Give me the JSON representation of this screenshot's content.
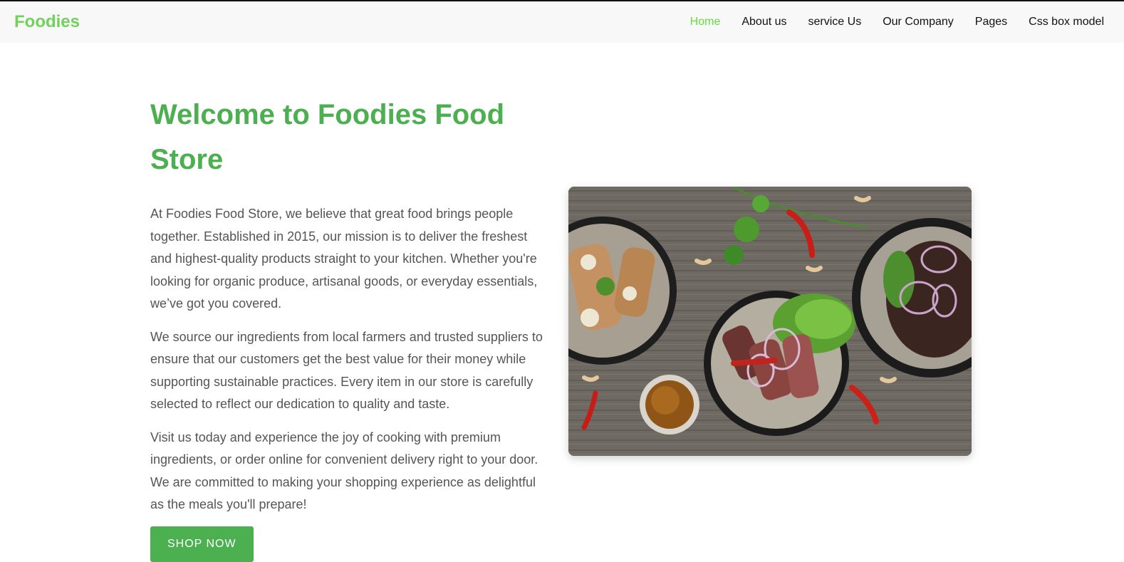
{
  "brand": {
    "name": "Foodies"
  },
  "nav": {
    "items": [
      {
        "label": "Home",
        "active": true
      },
      {
        "label": "About us"
      },
      {
        "label": "service Us"
      },
      {
        "label": "Our Company"
      },
      {
        "label": "Pages"
      },
      {
        "label": "Css box model"
      }
    ]
  },
  "main": {
    "title": "Welcome to Foodies Food Store",
    "paragraphs": [
      "At Foodies Food Store, we believe that great food brings people together. Established in 2015, our mission is to deliver the freshest and highest-quality products straight to your kitchen. Whether you're looking for organic produce, artisanal goods, or everyday essentials, we’ve got you covered.",
      "We source our ingredients from local farmers and trusted suppliers to ensure that our customers get the best value for their money while supporting sustainable practices. Every item in our store is carefully selected to reflect our dedication to quality and taste.",
      "Visit us today and experience the joy of cooking with premium ingredients, or order online for convenient delivery right to your door. We are committed to making your shopping experience as delightful as the meals you'll prepare!"
    ],
    "button_label": "SHOP NOW"
  },
  "colors": {
    "accent": "#4caf50",
    "brand": "#6fd35b",
    "nav_active": "#5fe03a",
    "navbar_bg": "#f8f8f8"
  }
}
